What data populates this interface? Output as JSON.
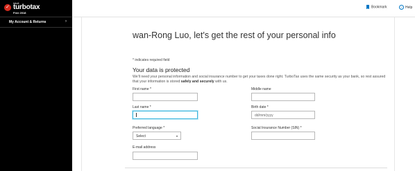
{
  "brand": {
    "mark": "✓",
    "company": "intuit",
    "product": "turbotax",
    "edition": "Free 2018"
  },
  "sidebar": {
    "items": [
      {
        "label": "My Account & Returns",
        "chevron": "›"
      }
    ]
  },
  "topbar": {
    "bookmark_label": "Bookmark",
    "help_label": "Help",
    "help_icon_glyph": "?"
  },
  "page": {
    "title": "wan-Rong Luo, let's get the rest of your personal info",
    "required_note": "* indicates required field",
    "section_heading": "Your data is protected",
    "paragraph_part1": "We'll need your personal information and social insurance number to get your taxes done right. TurboTax uses the same security as your bank, so rest assured that your information is stored ",
    "paragraph_bold": "safely and securely",
    "paragraph_part2": " with us."
  },
  "form": {
    "first_name": {
      "label": "First name *",
      "value": ""
    },
    "middle_name": {
      "label": "Middle name",
      "value": ""
    },
    "last_name": {
      "label": "Last name *",
      "value": ""
    },
    "birth_date": {
      "label": "Birth date *",
      "placeholder": "dd/mm/yyyy"
    },
    "preferred_language": {
      "label": "Preferred language *",
      "selected": "Select",
      "arrow": "▾"
    },
    "sin": {
      "label": "Social Insurance Number (SIN) *",
      "value": ""
    },
    "email": {
      "label": "E-mail address",
      "value": ""
    }
  },
  "colors": {
    "sidebar_bg": "#000000",
    "brand_red": "#d52b1e",
    "accent_blue": "#0077c5",
    "focus_border": "#3db6de"
  }
}
